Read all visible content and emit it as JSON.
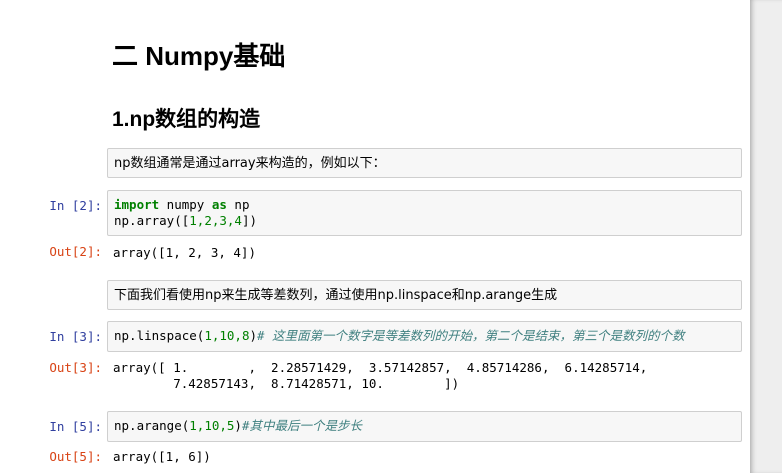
{
  "headings": {
    "h2": "二 Numpy基础",
    "h3": "1.np数组的构造"
  },
  "md1": "np数组通常是通过array来构造的，例如以下：",
  "md2": "下面我们看使用np来生成等差数列，通过使用np.linspace和np.arange生成",
  "cell2": {
    "in_prompt": "In  [2]:",
    "line1_kw1": "import",
    "line1_mod": " numpy ",
    "line1_kw2": "as",
    "line1_alias": " np",
    "line2_pre": "np.array([",
    "line2_nums": "1,2,3,4",
    "line2_post": "])",
    "out_prompt": "Out[2]:",
    "output": "array([1, 2, 3, 4])"
  },
  "cell3": {
    "in_prompt": "In  [3]:",
    "code_pre": "np.linspace(",
    "code_nums": "1,10,8",
    "code_post": ")",
    "comment": "# 这里面第一个数字是等差数列的开始，第二个是结束，第三个是数列的个数",
    "out_prompt": "Out[3]:",
    "output_line1": "array([ 1.        ,  2.28571429,  3.57142857,  4.85714286,  6.14285714,",
    "output_line2": "        7.42857143,  8.71428571, 10.        ])"
  },
  "cell5": {
    "in_prompt": "In  [5]:",
    "code_pre": "np.arange(",
    "code_nums": "1,10,5",
    "code_post": ")",
    "comment": "#其中最后一个是步长",
    "out_prompt": "Out[5]:",
    "output": "array([1, 6])"
  },
  "colors": {
    "in_prompt": "#303f9f",
    "out_prompt": "#d84315",
    "keyword": "#008000",
    "comment": "#408080",
    "cell_bg": "#f7f7f7",
    "cell_border": "#cfcfcf"
  }
}
